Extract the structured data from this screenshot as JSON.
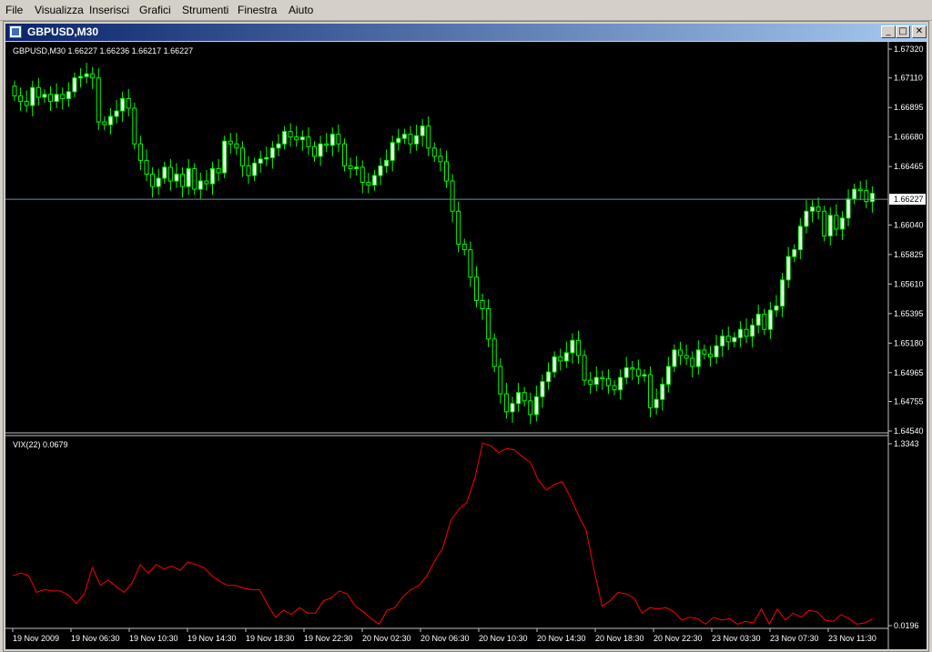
{
  "menu": [
    "File",
    "Visualizza",
    "Inserisci",
    "Grafici",
    "Strumenti",
    "Finestra",
    "Aiuto"
  ],
  "window": {
    "title": "GBPUSD,M30",
    "min_symbol": "_",
    "max_symbol": "□",
    "close_symbol": "✕"
  },
  "colors": {
    "background": "#000000",
    "bull_fill": "#ffffff",
    "wick": "#00ff00",
    "bear_fill": "#000000",
    "grid_axis": "#c0c0c0",
    "indicator": "#ff0000",
    "bid_line": "#6b8ea8"
  },
  "main_panel": {
    "header": "GBPUSD,M30  1.66227 1.66236 1.66217 1.66227",
    "current_price": "1.66227",
    "price_ticks": [
      "1.67320",
      "1.67110",
      "1.66895",
      "1.66680",
      "1.66465",
      "1.66040",
      "1.65825",
      "1.65610",
      "1.65395",
      "1.65180",
      "1.64965",
      "1.64755",
      "1.64540"
    ]
  },
  "indicator_panel": {
    "header": "VIX(22) 0.0679",
    "ticks": [
      "1.3343",
      "0.0196"
    ]
  },
  "time_axis": [
    "19 Nov 2009",
    "19 Nov 06:30",
    "19 Nov 10:30",
    "19 Nov 14:30",
    "19 Nov 18:30",
    "19 Nov 22:30",
    "20 Nov 02:30",
    "20 Nov 06:30",
    "20 Nov 10:30",
    "20 Nov 14:30",
    "20 Nov 18:30",
    "20 Nov 22:30",
    "23 Nov 03:30",
    "23 Nov 07:30",
    "23 Nov 11:30"
  ],
  "chart_data": [
    {
      "type": "candlestick",
      "title": "GBPUSD,M30",
      "ylim": [
        1.6454,
        1.6732
      ],
      "bid": 1.66227,
      "close": [
        1.6698,
        1.6694,
        1.6691,
        1.6704,
        1.6697,
        1.6699,
        1.6694,
        1.6699,
        1.6696,
        1.6701,
        1.6711,
        1.6712,
        1.6714,
        1.6711,
        1.6679,
        1.6677,
        1.6683,
        1.6687,
        1.6696,
        1.6689,
        1.6663,
        1.6651,
        1.6641,
        1.6632,
        1.6638,
        1.6646,
        1.6636,
        1.6641,
        1.6632,
        1.6645,
        1.663,
        1.6636,
        1.6634,
        1.6645,
        1.6642,
        1.6665,
        1.6663,
        1.666,
        1.6647,
        1.664,
        1.6649,
        1.6652,
        1.6653,
        1.666,
        1.6663,
        1.6672,
        1.6668,
        1.6666,
        1.6668,
        1.6661,
        1.6654,
        1.6663,
        1.6662,
        1.667,
        1.6663,
        1.6647,
        1.6645,
        1.6646,
        1.6635,
        1.6633,
        1.664,
        1.6647,
        1.6651,
        1.6664,
        1.6667,
        1.667,
        1.6663,
        1.6669,
        1.6676,
        1.666,
        1.6654,
        1.665,
        1.6636,
        1.6614,
        1.659,
        1.6586,
        1.6566,
        1.6549,
        1.6543,
        1.6521,
        1.6501,
        1.6481,
        1.6468,
        1.6474,
        1.6482,
        1.6476,
        1.6466,
        1.6479,
        1.649,
        1.6497,
        1.6508,
        1.6505,
        1.6511,
        1.652,
        1.6509,
        1.6491,
        1.6488,
        1.6493,
        1.6492,
        1.6487,
        1.6484,
        1.6493,
        1.65,
        1.6499,
        1.6494,
        1.6495,
        1.6471,
        1.6477,
        1.6488,
        1.6501,
        1.6513,
        1.6509,
        1.6507,
        1.6501,
        1.6513,
        1.651,
        1.6508,
        1.6516,
        1.6523,
        1.6519,
        1.6522,
        1.6528,
        1.6523,
        1.6531,
        1.6539,
        1.6528,
        1.6542,
        1.6545,
        1.6564,
        1.6581,
        1.6586,
        1.6603,
        1.6614,
        1.6617,
        1.6614,
        1.6596,
        1.6611,
        1.6601,
        1.6609,
        1.6623,
        1.663,
        1.6629,
        1.6621,
        1.6627
      ],
      "open": [
        1.6705,
        1.6698,
        1.6694,
        1.6691,
        1.6704,
        1.6697,
        1.6699,
        1.6694,
        1.6699,
        1.6696,
        1.6701,
        1.6711,
        1.6712,
        1.6714,
        1.6711,
        1.6679,
        1.6677,
        1.6683,
        1.6687,
        1.6696,
        1.6689,
        1.6663,
        1.6651,
        1.6641,
        1.6632,
        1.6638,
        1.6646,
        1.6636,
        1.6641,
        1.6632,
        1.6645,
        1.663,
        1.6636,
        1.6634,
        1.6645,
        1.6642,
        1.6665,
        1.6663,
        1.666,
        1.6647,
        1.664,
        1.6649,
        1.6652,
        1.6653,
        1.666,
        1.6663,
        1.6672,
        1.6668,
        1.6666,
        1.6668,
        1.6661,
        1.6654,
        1.6663,
        1.6662,
        1.667,
        1.6663,
        1.6647,
        1.6645,
        1.6646,
        1.6635,
        1.6633,
        1.664,
        1.6647,
        1.6651,
        1.6664,
        1.6667,
        1.667,
        1.6663,
        1.6669,
        1.6676,
        1.666,
        1.6654,
        1.665,
        1.6636,
        1.6614,
        1.659,
        1.6586,
        1.6566,
        1.6549,
        1.6543,
        1.6521,
        1.6501,
        1.6481,
        1.6468,
        1.6474,
        1.6482,
        1.6476,
        1.6466,
        1.6479,
        1.649,
        1.6497,
        1.6508,
        1.6505,
        1.6511,
        1.652,
        1.6509,
        1.6491,
        1.6488,
        1.6493,
        1.6492,
        1.6487,
        1.6484,
        1.6493,
        1.65,
        1.6499,
        1.6494,
        1.6495,
        1.6471,
        1.6477,
        1.6488,
        1.6501,
        1.6513,
        1.6509,
        1.6507,
        1.6501,
        1.6513,
        1.651,
        1.6508,
        1.6516,
        1.6523,
        1.6519,
        1.6522,
        1.6528,
        1.6523,
        1.6531,
        1.6539,
        1.6528,
        1.6542,
        1.6545,
        1.6564,
        1.6581,
        1.6586,
        1.6603,
        1.6614,
        1.6617,
        1.6614,
        1.6596,
        1.6611,
        1.6601,
        1.6609,
        1.6623,
        1.663,
        1.6629,
        1.6621
      ]
    },
    {
      "type": "line",
      "title": "VIX(22) 0.0679",
      "ylim": [
        0.0196,
        1.3343
      ],
      "values": [
        0.38,
        0.4,
        0.38,
        0.26,
        0.28,
        0.27,
        0.27,
        0.24,
        0.18,
        0.25,
        0.44,
        0.31,
        0.35,
        0.3,
        0.26,
        0.33,
        0.46,
        0.4,
        0.46,
        0.43,
        0.45,
        0.42,
        0.48,
        0.46,
        0.44,
        0.38,
        0.34,
        0.31,
        0.31,
        0.29,
        0.28,
        0.28,
        0.17,
        0.08,
        0.13,
        0.1,
        0.15,
        0.11,
        0.11,
        0.2,
        0.22,
        0.27,
        0.25,
        0.16,
        0.12,
        0.07,
        0.03,
        0.13,
        0.15,
        0.23,
        0.28,
        0.31,
        0.38,
        0.49,
        0.58,
        0.78,
        0.86,
        0.91,
        1.08,
        1.34,
        1.32,
        1.27,
        1.3,
        1.29,
        1.24,
        1.2,
        1.07,
        1.0,
        1.04,
        1.06,
        0.95,
        0.82,
        0.71,
        0.42,
        0.16,
        0.2,
        0.26,
        0.25,
        0.22,
        0.11,
        0.15,
        0.14,
        0.15,
        0.12,
        0.06,
        0.08,
        0.07,
        0.03,
        0.08,
        0.06,
        0.07,
        0.03,
        0.05,
        0.04,
        0.14,
        0.03,
        0.14,
        0.06,
        0.11,
        0.08,
        0.13,
        0.12,
        0.06,
        0.05,
        0.1,
        0.07,
        0.03,
        0.04,
        0.07
      ]
    }
  ]
}
